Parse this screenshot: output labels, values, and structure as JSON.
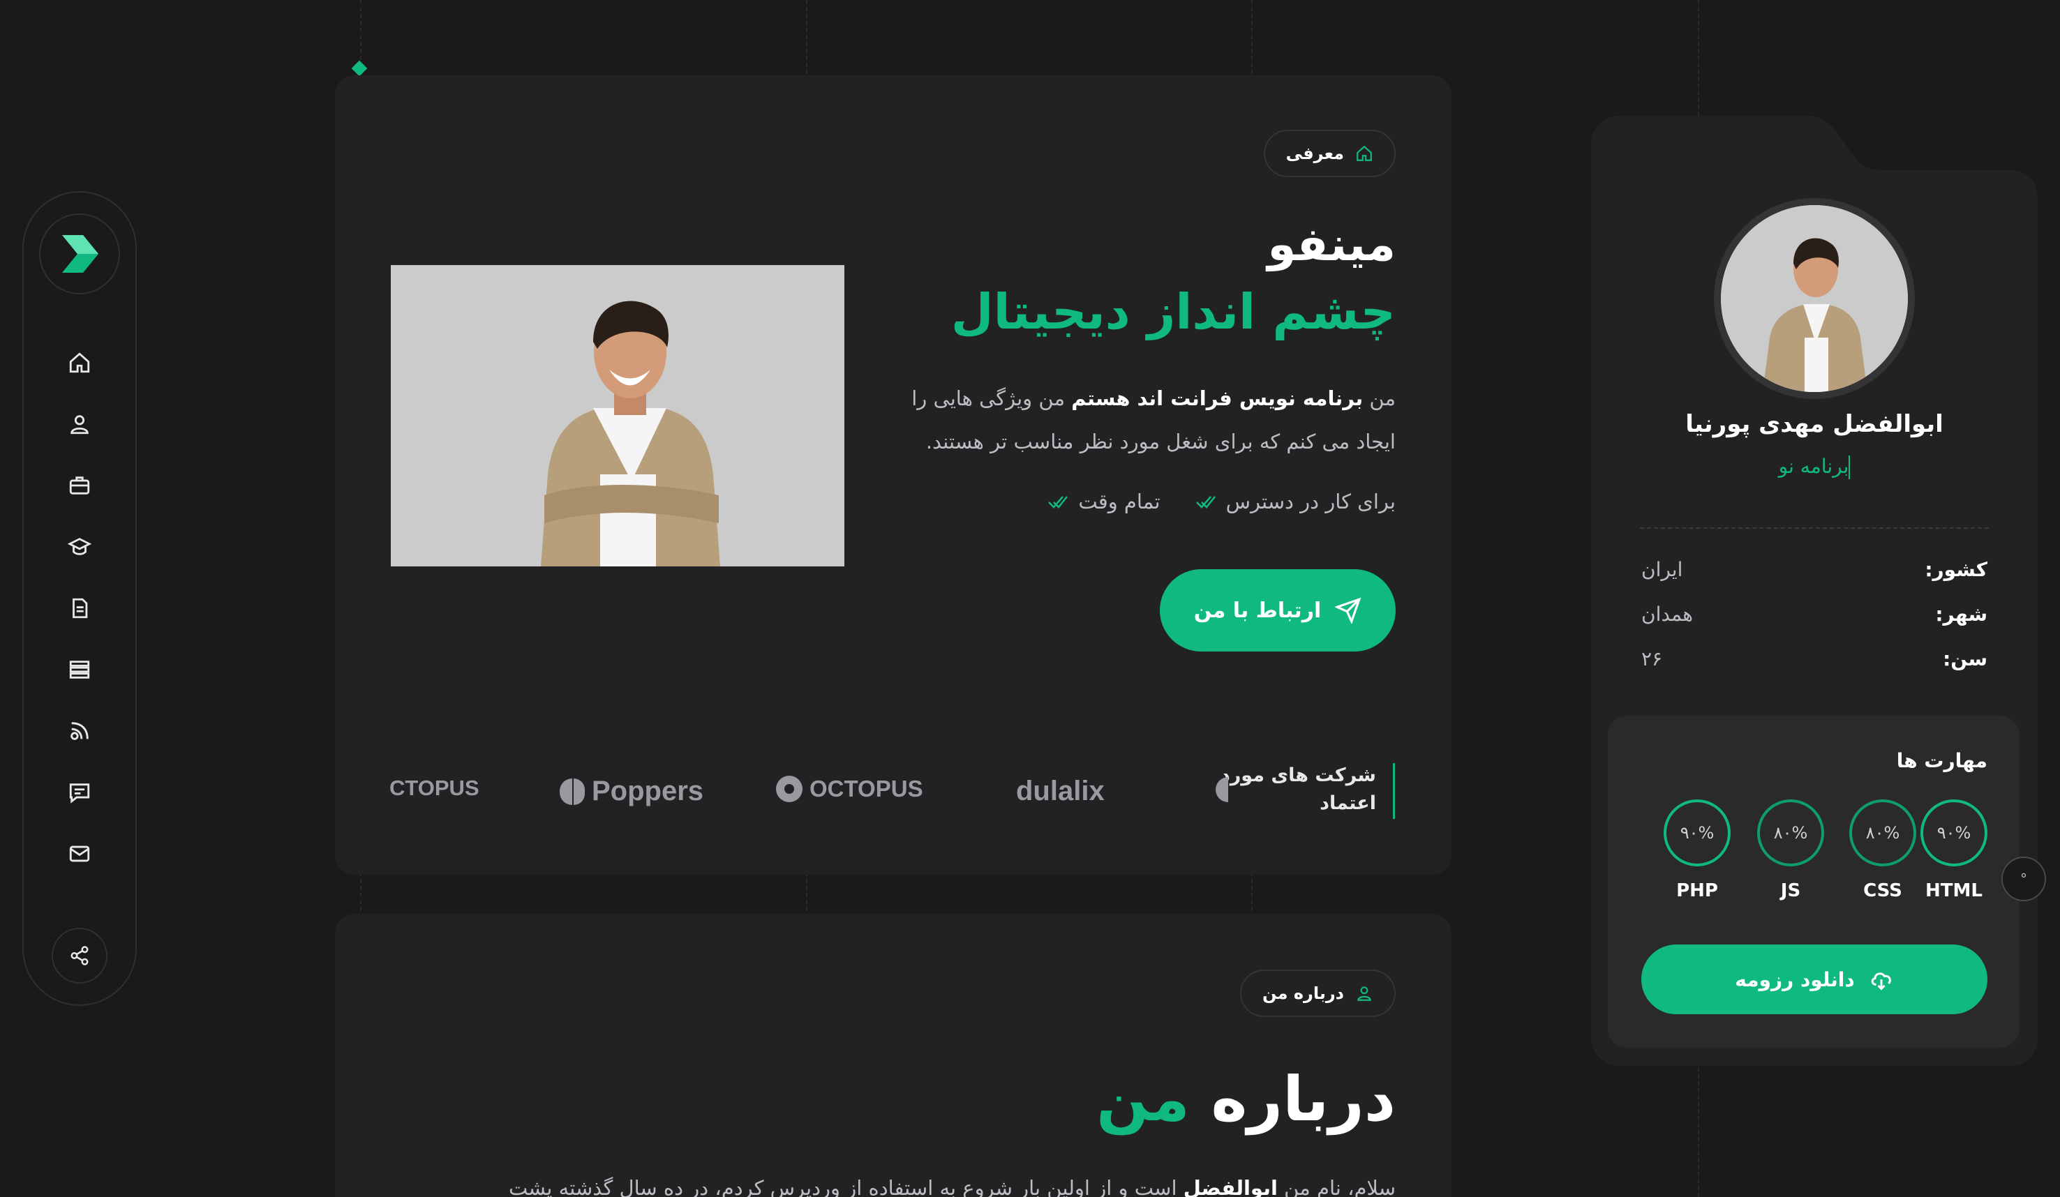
{
  "colors": {
    "accent": "#10b981",
    "background": "#1a1a1c",
    "card": "#222224"
  },
  "sidebar": {
    "items": [
      {
        "icon": "home-icon"
      },
      {
        "icon": "user-icon"
      },
      {
        "icon": "briefcase-icon"
      },
      {
        "icon": "graduation-cap-icon"
      },
      {
        "icon": "document-icon"
      },
      {
        "icon": "grid-icon"
      },
      {
        "icon": "feed-icon"
      },
      {
        "icon": "chat-icon"
      },
      {
        "icon": "mail-icon"
      }
    ],
    "share_icon": "share-icon",
    "logo_icon": "chevron-logo-icon"
  },
  "hero": {
    "pill_label": "معرفی",
    "name": "مینفو",
    "headline": "چشم انداز دیجیتال",
    "desc_part1": "من ",
    "desc_bold": "برنامه نویس فرانت اند هستم",
    "desc_part2": " من ویژگی هایی را",
    "desc_line2": "ایجاد می کنم که برای شغل مورد نظر مناسب تر هستند.",
    "feature1": "برای کار در دسترس",
    "feature2": "تمام وقت",
    "contact_button": "ارتباط با من",
    "trusted_label_line1": "شرکت های مورد",
    "trusted_label_line2": "اعتماد",
    "logos": [
      "dulalix",
      "OCTOPUS",
      "Poppers",
      "CTOPUS"
    ]
  },
  "about": {
    "pill_label": "درباره من",
    "title_white": "درباره",
    "title_green": "من",
    "text_start": "سلام، نام من ",
    "text_bold": "ابوالفضل",
    "text_rest": " است و از اولین بار شروع به استفاده از وردپرس کردم، در ده سال گذشته پشت"
  },
  "profile": {
    "name": "ابوالفضل مهدی پورنیا",
    "role": "برنامه نو",
    "info": [
      {
        "key": "کشور:",
        "value": "ایران"
      },
      {
        "key": "شهر:",
        "value": "همدان"
      },
      {
        "key": "سن:",
        "value": "۲۶"
      }
    ],
    "skills_title": "مهارت ها",
    "skills": [
      {
        "name": "HTML",
        "value": "۹۰%"
      },
      {
        "name": "CSS",
        "value": "۸۰%"
      },
      {
        "name": "JS",
        "value": "۸۰%"
      },
      {
        "name": "PHP",
        "value": "۹۰%"
      }
    ],
    "download_button": "دانلود رزومه"
  },
  "float_button": "°"
}
